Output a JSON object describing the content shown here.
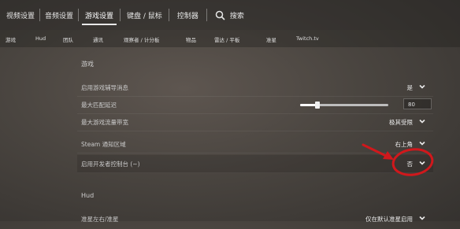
{
  "top_tabs": [
    {
      "label": "视频设置"
    },
    {
      "label": "音频设置"
    },
    {
      "label": "游戏设置"
    },
    {
      "label": "键盘 / 鼠标"
    },
    {
      "label": "控制器"
    }
  ],
  "search_label": "搜索",
  "sub_tabs": [
    "游戏",
    "Hud",
    "团队",
    "通讯",
    "观察者 / 计分板",
    "物品",
    "雷达 / 平板",
    "准星",
    "Twitch.tv"
  ],
  "sections": {
    "game_title": "游戏",
    "hud_title": "Hud"
  },
  "settings": [
    {
      "label": "启用游戏辅导消息",
      "value": "是"
    },
    {
      "label": "最大匹配延迟",
      "value": "80",
      "slider_level": 0.2
    },
    {
      "label": "最大游戏流量带宽",
      "value": "极其受限"
    },
    {
      "label": "Steam 通知区域",
      "value": "右上角"
    },
    {
      "label": "启用开发者控制台 (~)",
      "value": "否"
    },
    {
      "label": "准星左右/准星",
      "value": "仅在默认准星启用"
    }
  ],
  "colors": {
    "annotation": "#d0181c"
  }
}
